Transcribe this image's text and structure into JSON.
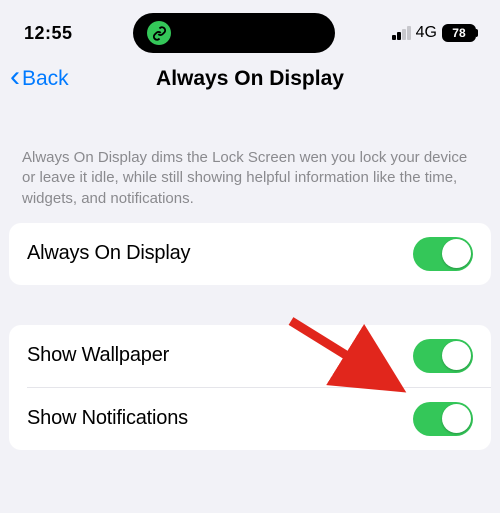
{
  "status": {
    "time": "12:55",
    "cellular": "4G",
    "battery": "78"
  },
  "nav": {
    "back": "Back",
    "title": "Always On Display"
  },
  "description": "Always On Display dims the Lock Screen wen you lock your device or leave it idle, while still showing helpful information like the time, widgets, and notifications.",
  "settings": {
    "main": {
      "label": "Always On Display",
      "value": true
    },
    "wallpaper": {
      "label": "Show Wallpaper",
      "value": true
    },
    "notifications": {
      "label": "Show Notifications",
      "value": true
    }
  },
  "colors": {
    "toggle_on": "#34c759",
    "accent": "#007aff",
    "arrow": "#e1261c"
  }
}
